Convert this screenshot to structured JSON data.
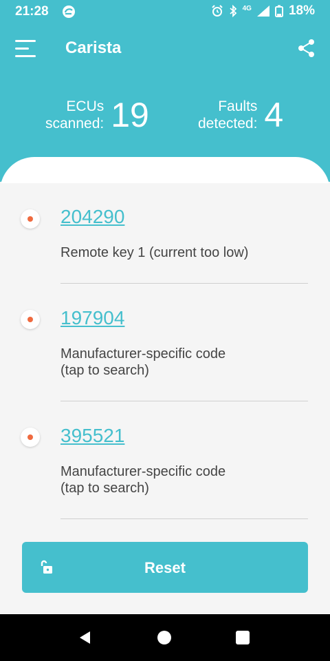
{
  "status_bar": {
    "time": "21:28",
    "battery": "18%",
    "network": "4G",
    "icons": [
      "sync-icon",
      "alarm-icon",
      "bluetooth-icon",
      "signal-icon",
      "battery-icon"
    ]
  },
  "header": {
    "title": "Carista",
    "menu_icon": "hamburger-menu-icon",
    "share_icon": "share-icon",
    "stats": {
      "ecus_label_line1": "ECUs",
      "ecus_label_line2": "scanned:",
      "ecus_value": "19",
      "faults_label_line1": "Faults",
      "faults_label_line2": "detected:",
      "faults_value": "4"
    }
  },
  "faults": [
    {
      "code": "204290",
      "desc_line1": "Remote key 1 (current too low)",
      "desc_line2": ""
    },
    {
      "code": "197904",
      "desc_line1": "Manufacturer-specific code",
      "desc_line2": "(tap to search)"
    },
    {
      "code": "395521",
      "desc_line1": "Manufacturer-specific code",
      "desc_line2": "(tap to search)"
    }
  ],
  "reset": {
    "label": "Reset",
    "icon": "unlock-icon"
  },
  "nav": {
    "back": "back-icon",
    "home": "home-icon",
    "recents": "recents-icon"
  },
  "colors": {
    "primary": "#45bfcd",
    "dot": "#ef6a3f",
    "background": "#f5f5f5"
  }
}
